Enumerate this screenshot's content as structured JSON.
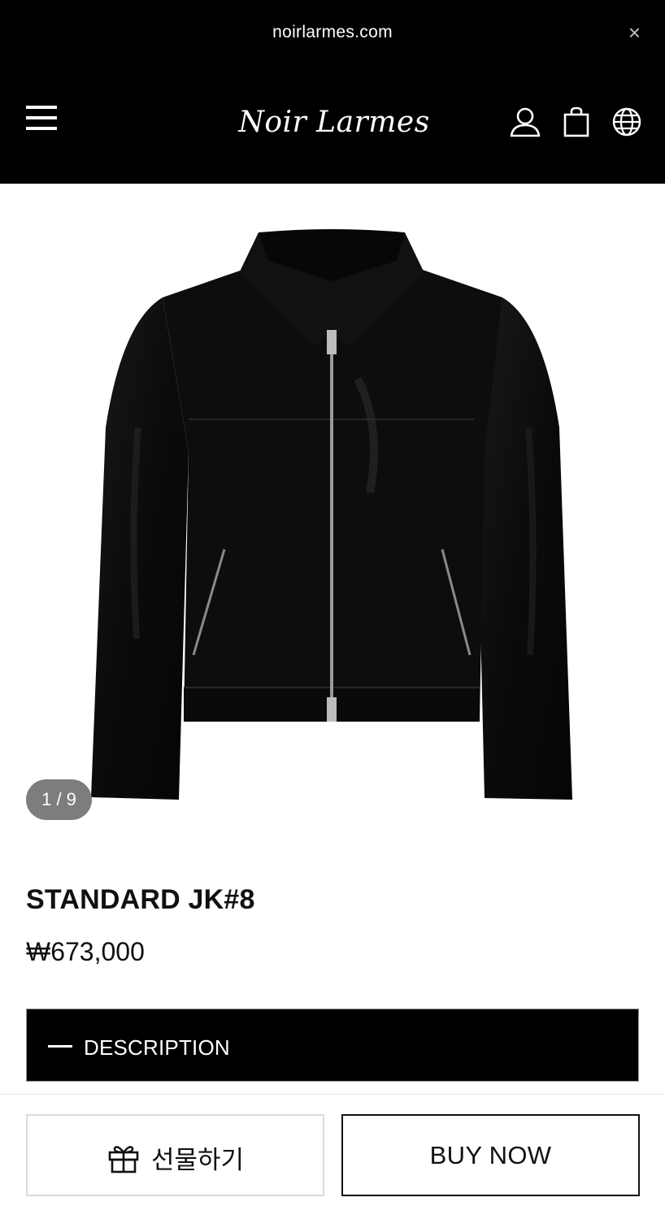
{
  "browser": {
    "url": "noirlarmes.com",
    "close_symbol": "×"
  },
  "header": {
    "logo_text": "Noir Larmes",
    "icons": [
      "menu-icon",
      "account-icon",
      "shopping-bag-icon",
      "globe-icon"
    ]
  },
  "gallery": {
    "counter": "1 / 9"
  },
  "product": {
    "name": "STANDARD JK#8",
    "price": "₩673,000"
  },
  "description": {
    "label": "DESCRIPTION"
  },
  "actions": {
    "gift_label": "선물하기",
    "buy_label": "BUY NOW"
  },
  "colors": {
    "header_bg": "#000000",
    "counter_bg": "#7d7d7d",
    "page_bg": "#ffffff"
  }
}
